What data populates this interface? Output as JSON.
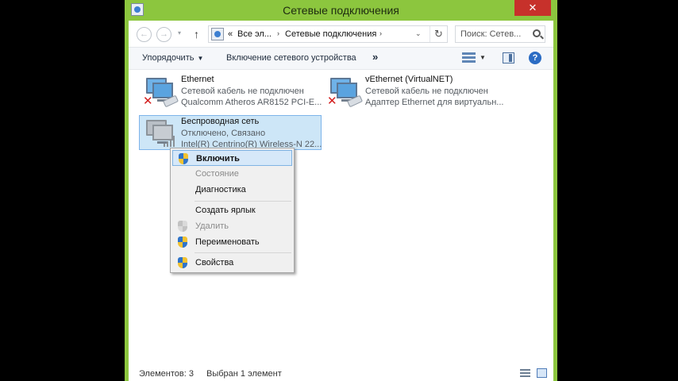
{
  "window": {
    "title": "Сетевые подключения",
    "close_glyph": "✕"
  },
  "address": {
    "back_glyph": "←",
    "forward_glyph": "→",
    "recent_glyph": "▾",
    "up_glyph": "↑",
    "overflow": "«",
    "crumbs": [
      "Все эл...",
      "Сетевые подключения"
    ],
    "crumb_chevron": "›",
    "dropdown_glyph": "⌄",
    "refresh_glyph": "↻",
    "search_placeholder": "Поиск: Сетев..."
  },
  "toolbar": {
    "organize": "Упорядочить",
    "organize_arrow": "▼",
    "enable_device": "Включение сетевого устройства",
    "more": "»",
    "view_arrow": "▼",
    "help": "?"
  },
  "connections": [
    {
      "name": "Ethernet",
      "status": "Сетевой кабель не подключен",
      "device": "Qualcomm Atheros AR8152 PCI-E...",
      "error_glyph": "✕"
    },
    {
      "name": "vEthernet (VirtualNET)",
      "status": "Сетевой кабель не подключен",
      "device": "Адаптер Ethernet для виртуальн...",
      "error_glyph": "✕"
    },
    {
      "name": "Беспроводная сеть",
      "status": "Отключено, Связано",
      "device": "Intel(R) Centrino(R) Wireless-N 22..."
    }
  ],
  "context_menu": {
    "items": [
      {
        "label": "Включить"
      },
      {
        "label": "Состояние"
      },
      {
        "label": "Диагностика"
      },
      {
        "label": "Создать ярлык"
      },
      {
        "label": "Удалить"
      },
      {
        "label": "Переименовать"
      },
      {
        "label": "Свойства"
      }
    ]
  },
  "status": {
    "count": "Элементов: 3",
    "selected": "Выбран 1 элемент"
  },
  "colors": {
    "title_bar": "#8cc63e",
    "close": "#c7312b",
    "selection": "#cde6f7",
    "menu_highlight": "#d6e8f9",
    "error": "#d31e1e"
  }
}
